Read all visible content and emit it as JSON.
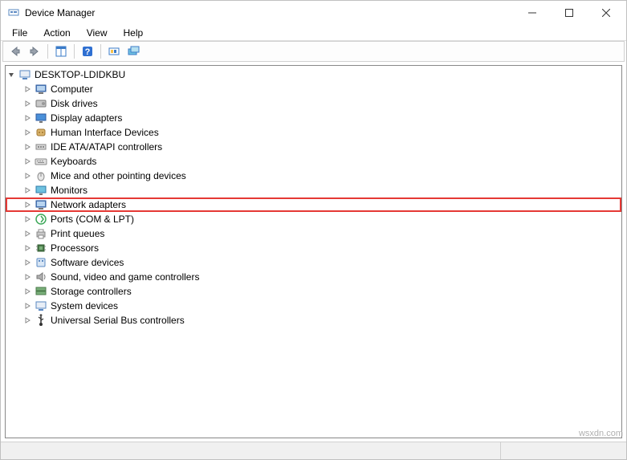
{
  "window": {
    "title": "Device Manager"
  },
  "menubar": {
    "items": [
      "File",
      "Action",
      "View",
      "Help"
    ]
  },
  "toolbar": {
    "buttons": [
      "back",
      "forward",
      "_sep_",
      "properties-panel",
      "_sep_",
      "help",
      "_sep_",
      "scan-hardware",
      "show-hidden"
    ]
  },
  "tree": {
    "root": {
      "label": "DESKTOP-LDIDKBU",
      "icon": "desktop-icon",
      "expanded": true
    },
    "children": [
      {
        "label": "Computer",
        "icon": "computer-icon"
      },
      {
        "label": "Disk drives",
        "icon": "disk-icon"
      },
      {
        "label": "Display adapters",
        "icon": "display-icon"
      },
      {
        "label": "Human Interface Devices",
        "icon": "hid-icon"
      },
      {
        "label": "IDE ATA/ATAPI controllers",
        "icon": "ide-icon"
      },
      {
        "label": "Keyboards",
        "icon": "keyboard-icon"
      },
      {
        "label": "Mice and other pointing devices",
        "icon": "mouse-icon"
      },
      {
        "label": "Monitors",
        "icon": "monitor-icon"
      },
      {
        "label": "Network adapters",
        "icon": "network-icon",
        "highlighted": true
      },
      {
        "label": "Ports (COM & LPT)",
        "icon": "ports-icon"
      },
      {
        "label": "Print queues",
        "icon": "printer-icon"
      },
      {
        "label": "Processors",
        "icon": "cpu-icon"
      },
      {
        "label": "Software devices",
        "icon": "software-icon"
      },
      {
        "label": "Sound, video and game controllers",
        "icon": "sound-icon"
      },
      {
        "label": "Storage controllers",
        "icon": "storage-icon"
      },
      {
        "label": "System devices",
        "icon": "system-icon"
      },
      {
        "label": "Universal Serial Bus controllers",
        "icon": "usb-icon"
      }
    ]
  },
  "watermark": "wsxdn.com"
}
